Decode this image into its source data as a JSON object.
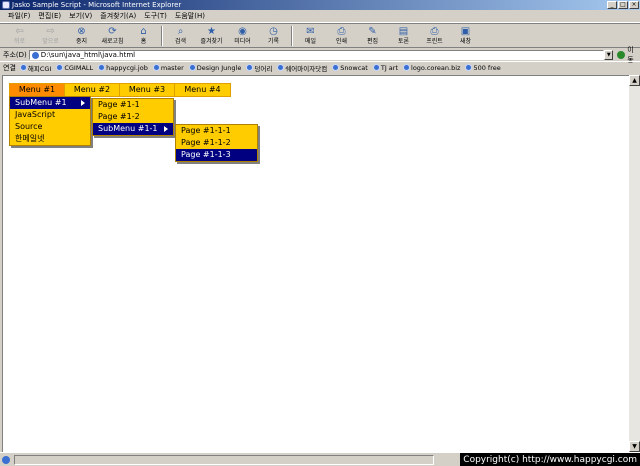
{
  "window": {
    "title": "Jasko Sample Script - Microsoft Internet Explorer"
  },
  "menubar": [
    "파일(F)",
    "편집(E)",
    "보기(V)",
    "즐겨찾기(A)",
    "도구(T)",
    "도움말(H)"
  ],
  "toolbar": [
    {
      "label": "뒤로",
      "icon": "back-icon",
      "glyph": "⇦",
      "disabled": true
    },
    {
      "label": "앞으로",
      "icon": "forward-icon",
      "glyph": "⇨",
      "disabled": true
    },
    {
      "label": "중지",
      "icon": "stop-icon",
      "glyph": "⊗",
      "disabled": false
    },
    {
      "label": "새로고침",
      "icon": "refresh-icon",
      "glyph": "⟳",
      "disabled": false
    },
    {
      "label": "홈",
      "icon": "home-icon",
      "glyph": "⌂",
      "disabled": false
    },
    {
      "label": "검색",
      "icon": "search-icon",
      "glyph": "⌕",
      "disabled": false
    },
    {
      "label": "즐겨찾기",
      "icon": "favorites-icon",
      "glyph": "★",
      "disabled": false
    },
    {
      "label": "미디어",
      "icon": "media-icon",
      "glyph": "◉",
      "disabled": false
    },
    {
      "label": "기록",
      "icon": "history-icon",
      "glyph": "◷",
      "disabled": false
    },
    {
      "label": "메일",
      "icon": "mail-icon",
      "glyph": "✉",
      "disabled": false
    },
    {
      "label": "인쇄",
      "icon": "print-icon",
      "glyph": "⎙",
      "disabled": false
    },
    {
      "label": "편집",
      "icon": "edit-icon",
      "glyph": "✎",
      "disabled": false
    },
    {
      "label": "토론",
      "icon": "discuss-icon",
      "glyph": "▤",
      "disabled": false
    },
    {
      "label": "프린트",
      "icon": "printer-icon",
      "glyph": "⎙",
      "disabled": false
    },
    {
      "label": "새창",
      "icon": "new-window-icon",
      "glyph": "▣",
      "disabled": false
    }
  ],
  "address": {
    "label": "주소(D)",
    "value": "D:\\sun\\java_html\\java.html",
    "go": "이동"
  },
  "links": {
    "label": "연결",
    "items": [
      "해피CGI",
      "CGIMALL",
      "happycgi.job",
      "master",
      "Design Jungle",
      "덩어리",
      "쉐어마이자닷컴",
      "Snowcat",
      "TJ art",
      "logo.corean.biz",
      "500 free"
    ]
  },
  "dhtml_menu": {
    "top": [
      "Menu #1",
      "Menu #2",
      "Menu #3",
      "Menu #4"
    ],
    "sub1": [
      "SubMenu #1",
      "JavaScript",
      "Source",
      "한메일넷"
    ],
    "sub2": [
      "Page #1-1",
      "Page #1-2",
      "SubMenu #1-1"
    ],
    "sub3": [
      "Page #1-1-1",
      "Page #1-1-2",
      "Page #1-1-3"
    ]
  },
  "status": {
    "copyright": "Copyright(c) http://www.happycgi.com"
  }
}
